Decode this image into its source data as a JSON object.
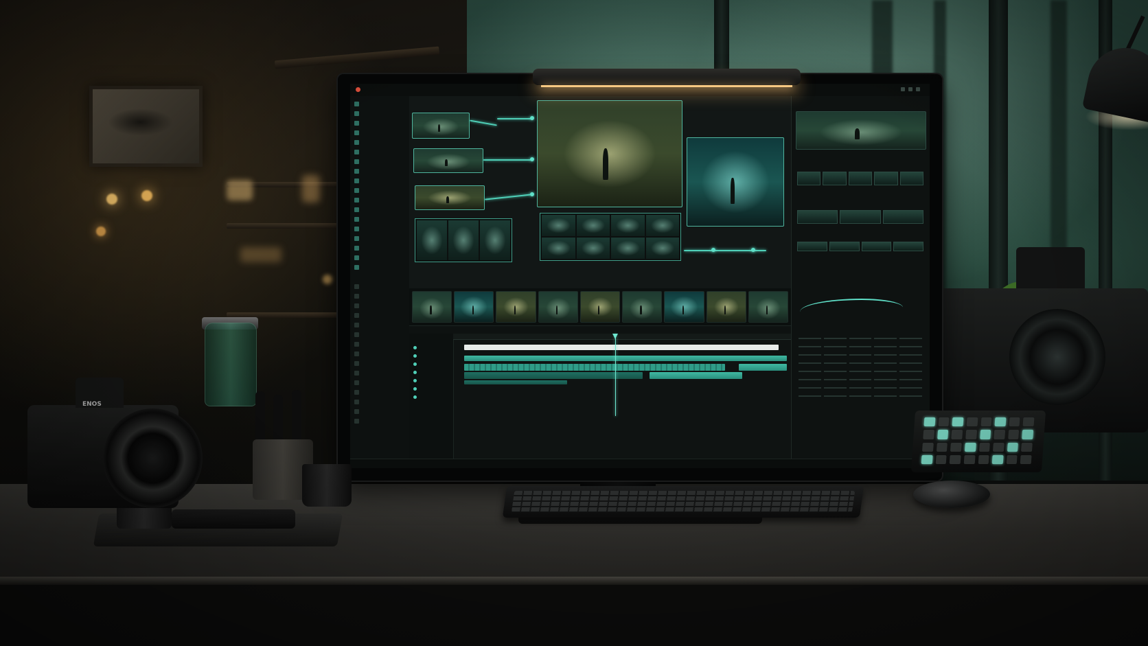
{
  "camera_brand": "ENOS"
}
